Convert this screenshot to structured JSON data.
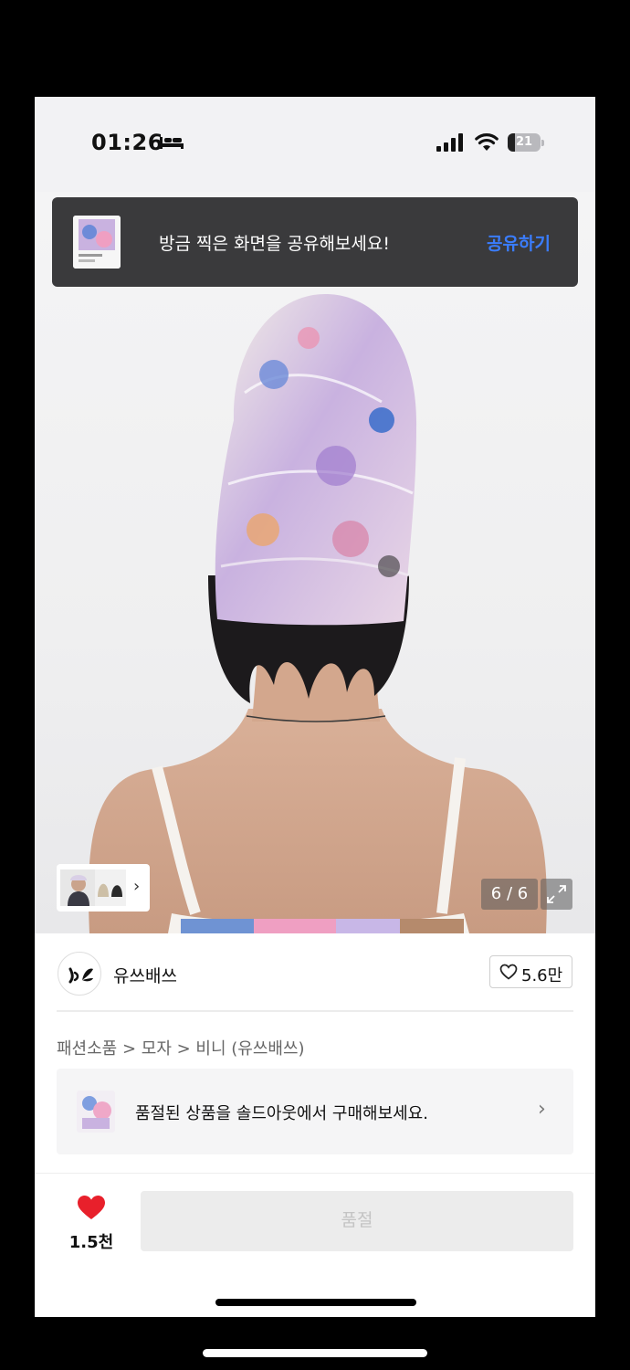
{
  "status_bar": {
    "time": "01:26",
    "battery": "21",
    "battery_level": 0.21,
    "icons": [
      "bed-icon",
      "signal-icon",
      "wifi-icon",
      "battery-icon"
    ]
  },
  "toast": {
    "message": "방금 찍은 화면을 공유해보세요!",
    "action": "공유하기",
    "action_color": "#3a7dff"
  },
  "gallery": {
    "counter": "6 / 6",
    "icons": [
      "chevron-right-icon",
      "expand-icon"
    ]
  },
  "seller": {
    "name": "유쓰배쓰",
    "likes": "5.6만"
  },
  "breadcrumb": "패션소품 > 모자 > 비니 (유쓰배쓰)",
  "promo": {
    "text": "품절된 상품을 솔드아웃에서 구매해보세요."
  },
  "bottom_bar": {
    "wishlist_count": "1.5천",
    "wishlist_color": "#e8202b",
    "buy_label": "품절"
  }
}
